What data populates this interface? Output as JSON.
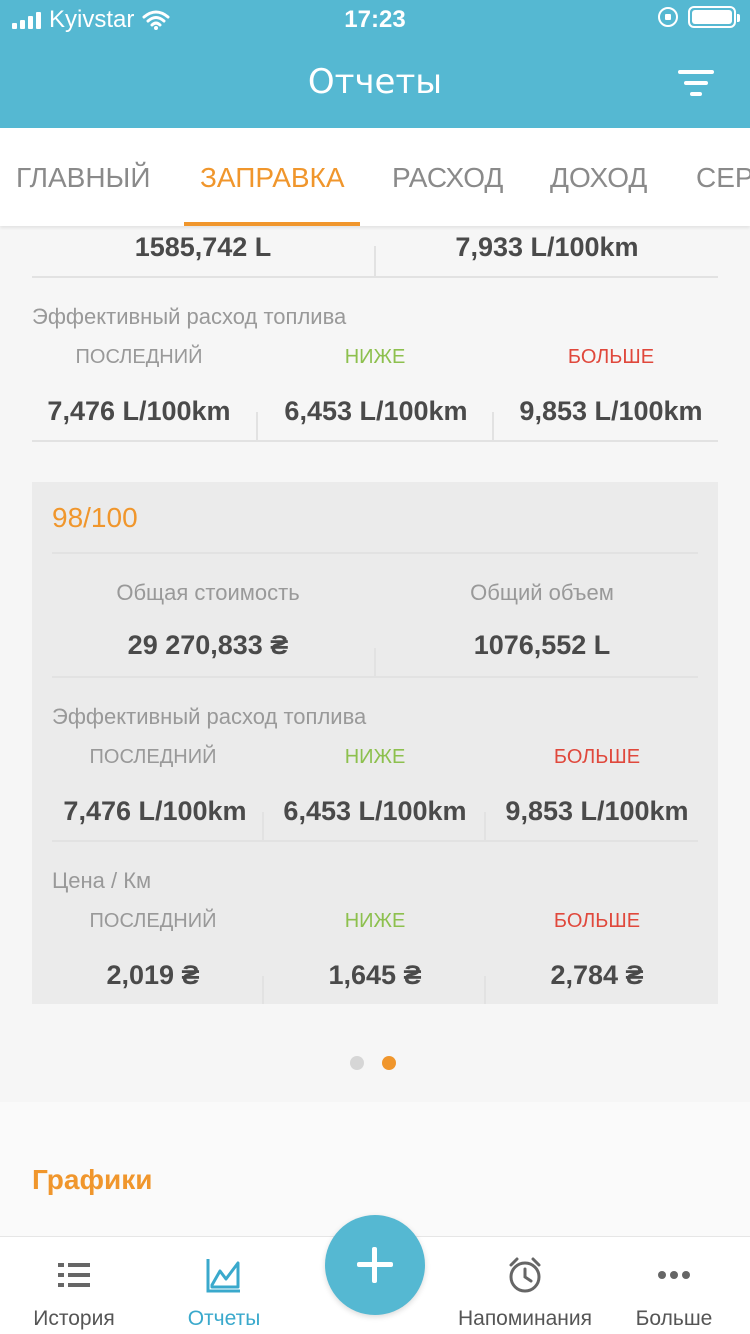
{
  "status": {
    "carrier": "Kyivstar",
    "time": "17:23"
  },
  "header": {
    "title": "Отчеты"
  },
  "tabs": [
    {
      "label": "ГЛАВНЫЙ",
      "active": false
    },
    {
      "label": "ЗАПРАВКА",
      "active": true
    },
    {
      "label": "РАСХОД",
      "active": false
    },
    {
      "label": "ДОХОД",
      "active": false
    },
    {
      "label": "СЕР",
      "active": false
    }
  ],
  "top_block": {
    "volume": "1585,742 L",
    "avg": "7,933 L/100km",
    "eff_label": "Эффективный расход топлива",
    "last_label": "ПОСЛЕДНИЙ",
    "lower_label": "НИЖЕ",
    "higher_label": "БОЛЬШЕ",
    "last": "7,476 L/100km",
    "lower": "6,453 L/100km",
    "higher": "9,853 L/100km"
  },
  "card": {
    "title": "98/100",
    "total_cost_label": "Общая стоимость",
    "total_volume_label": "Общий объем",
    "total_cost": "29 270,833 ₴",
    "total_volume": "1076,552 L",
    "eff_label": "Эффективный расход топлива",
    "last_label": "ПОСЛЕДНИЙ",
    "lower_label": "НИЖЕ",
    "higher_label": "БОЛЬШЕ",
    "eff_last": "7,476 L/100km",
    "eff_lower": "6,453 L/100km",
    "eff_higher": "9,853 L/100km",
    "price_label": "Цена / Км",
    "price_last": "2,019 ₴",
    "price_lower": "1,645 ₴",
    "price_higher": "2,784 ₴"
  },
  "pager": {
    "count": 2,
    "active_index": 1
  },
  "charts_section": {
    "title": "Графики"
  },
  "bottom_nav": {
    "history": "История",
    "reports": "Отчеты",
    "reminders": "Напоминания",
    "more": "Больше"
  },
  "colors": {
    "header": "#55b8d2",
    "accent": "#f0962c",
    "green": "#8dc04e",
    "red": "#e0483c"
  }
}
